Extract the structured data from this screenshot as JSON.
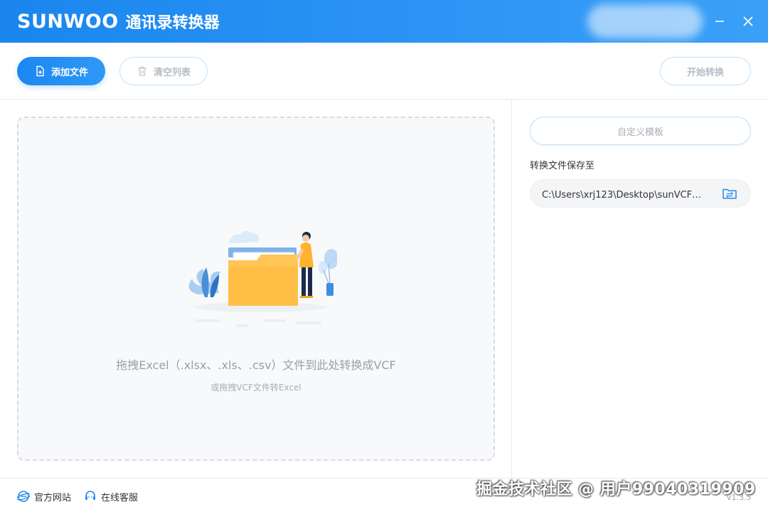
{
  "app": {
    "logo_text": "SUNWOO",
    "title": "通讯录转换器",
    "version": "v1.3.5",
    "accent_color": "#1E88F0"
  },
  "window_controls": {
    "minimize_icon": "minimize-icon",
    "close_icon": "close-icon"
  },
  "toolbar": {
    "add_file_label": "添加文件",
    "clear_list_label": "清空列表",
    "start_convert_label": "开始转换"
  },
  "dropzone": {
    "main_text": "拖拽Excel（.xlsx、.xls、.csv）文件到此处转换成VCF",
    "sub_text": "或拖拽VCF文件转Excel"
  },
  "settings": {
    "custom_template_label": "自定义模板",
    "save_to_label": "转换文件保存至",
    "save_path": "C:\\Users\\xrj123\\Desktop\\sunVCF通..."
  },
  "footer": {
    "official_site_label": "官方网站",
    "online_service_label": "在线客服"
  },
  "watermark": "掘金技术社区 @ 用户99040319909"
}
